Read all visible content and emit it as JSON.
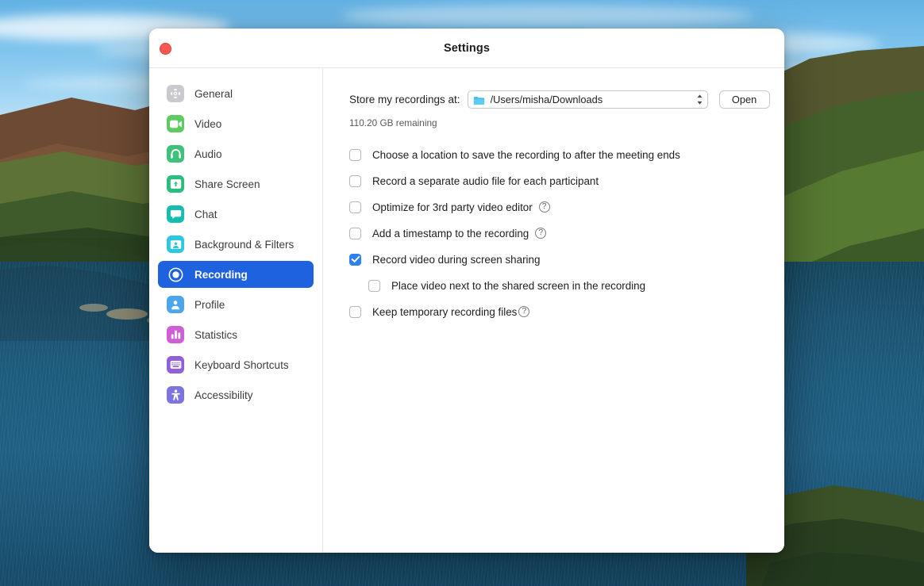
{
  "window": {
    "title": "Settings",
    "close_button": "close"
  },
  "sidebar": {
    "items": [
      {
        "label": "General",
        "icon": "gear-icon",
        "color": "#c9c9ce",
        "selected": false
      },
      {
        "label": "Video",
        "icon": "video-camera-icon",
        "color": "#5ecb62",
        "selected": false
      },
      {
        "label": "Audio",
        "icon": "headphones-icon",
        "color": "#3ec17a",
        "selected": false
      },
      {
        "label": "Share Screen",
        "icon": "share-screen-icon",
        "color": "#29bd7e",
        "selected": false
      },
      {
        "label": "Chat",
        "icon": "chat-bubble-icon",
        "color": "#17bcb0",
        "selected": false
      },
      {
        "label": "Background & Filters",
        "icon": "person-frame-icon",
        "color": "#2cc8e0",
        "selected": false
      },
      {
        "label": "Recording",
        "icon": "record-circle-icon",
        "color": "#1f62e0",
        "selected": true
      },
      {
        "label": "Profile",
        "icon": "person-icon",
        "color": "#4ca6ec",
        "selected": false
      },
      {
        "label": "Statistics",
        "icon": "bar-chart-icon",
        "color": "#cf5fd4",
        "selected": false
      },
      {
        "label": "Keyboard Shortcuts",
        "icon": "keyboard-icon",
        "color": "#9060d8",
        "selected": false
      },
      {
        "label": "Accessibility",
        "icon": "accessibility-icon",
        "color": "#7e74dd",
        "selected": false
      }
    ],
    "selected_accent": "#1f62e0"
  },
  "main": {
    "store_label": "Store my recordings at:",
    "path_value": "/Users/misha/Downloads",
    "path_icon": "folder-icon",
    "stepper_icon": "stepper-up-down-icon",
    "open_label": "Open",
    "remaining": "110.20 GB remaining",
    "options": [
      {
        "label": "Choose a location to save the recording to after the meeting ends",
        "checked": false,
        "help": false,
        "indented": false
      },
      {
        "label": "Record a separate audio file for each participant",
        "checked": false,
        "help": false,
        "indented": false
      },
      {
        "label": "Optimize for 3rd party video editor",
        "checked": false,
        "help": true,
        "indented": false
      },
      {
        "label": "Add a timestamp to the recording",
        "checked": false,
        "help": true,
        "indented": false
      },
      {
        "label": "Record video during screen sharing",
        "checked": true,
        "help": false,
        "indented": false
      },
      {
        "label": "Place video next to the shared screen in the recording",
        "checked": false,
        "help": false,
        "indented": true
      },
      {
        "label": "Keep temporary recording files",
        "checked": false,
        "help": true,
        "indented": false,
        "help_tight": true
      }
    ],
    "help_glyph": "?",
    "checkbox_accent": "#2d7ff2"
  }
}
